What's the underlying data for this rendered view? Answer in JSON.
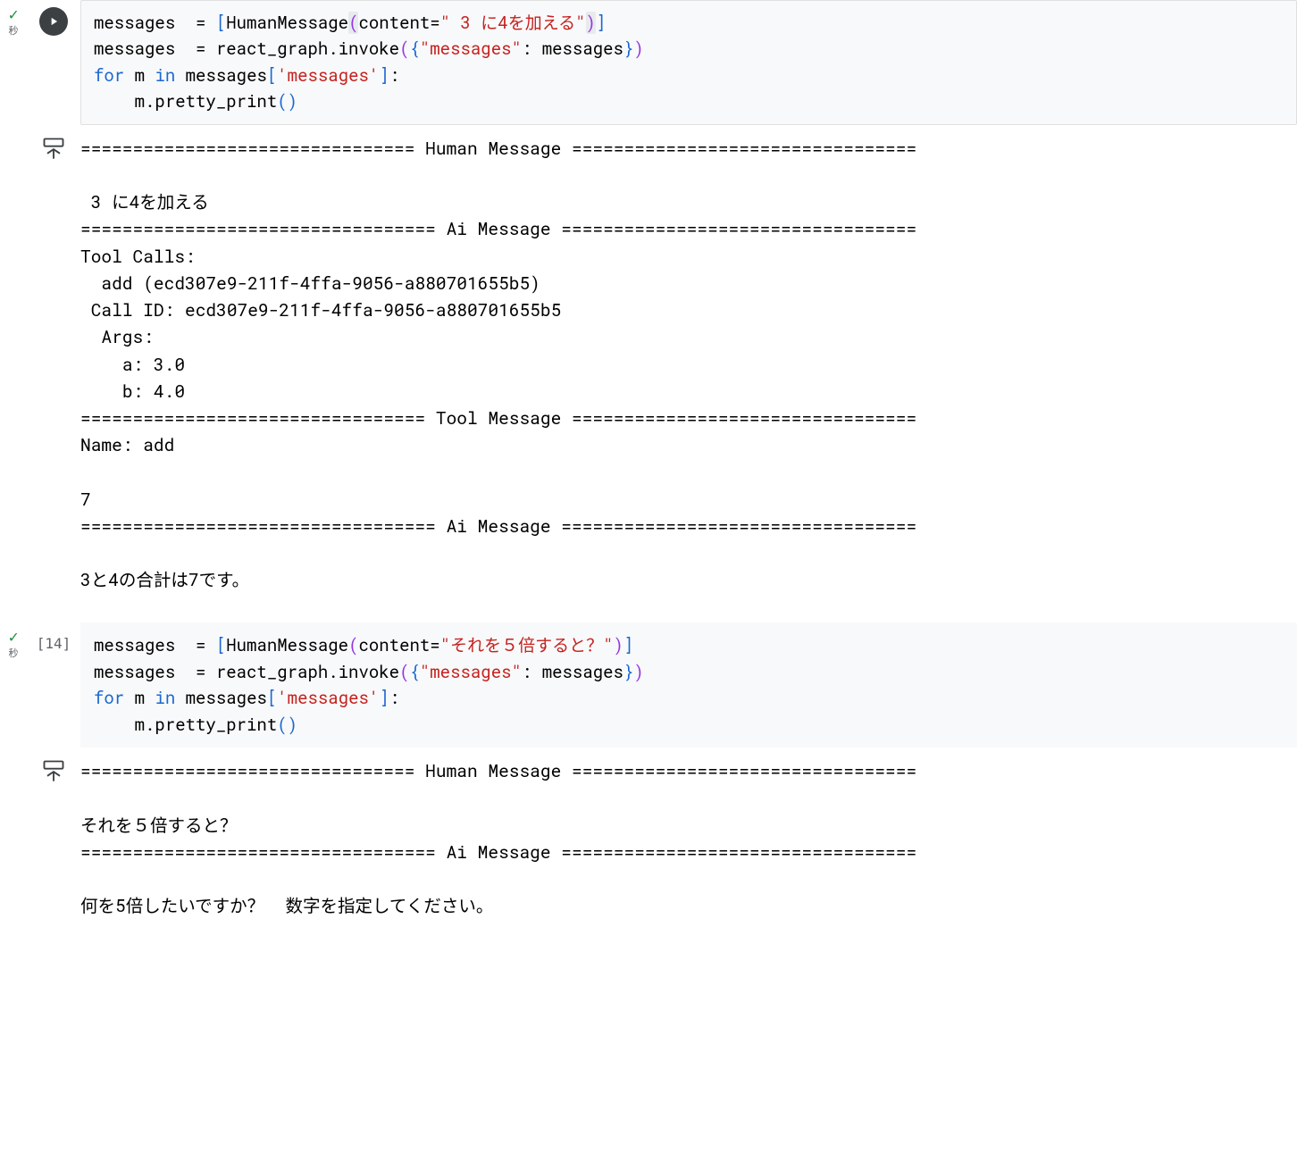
{
  "cells": [
    {
      "status_check": "✓",
      "status_seconds": "秒",
      "exec_label": "",
      "show_play": true,
      "code_tokens": [
        [
          "messages ",
          " = ",
          [
            "brk",
            "["
          ],
          "HumanMessage",
          [
            "hlpar",
            "("
          ],
          "content",
          [
            "op",
            "="
          ],
          [
            "str",
            "\" 3 に4を加える\""
          ],
          [
            "hlpar",
            ")"
          ],
          [
            "brk",
            "]"
          ]
        ],
        [
          "messages ",
          " = ",
          "react_graph",
          ".",
          "invoke",
          [
            "brk2",
            "("
          ],
          [
            "brk",
            "{"
          ],
          [
            "str",
            "\"messages\""
          ],
          ": messages",
          [
            "brk",
            "}"
          ],
          [
            "brk2",
            ")"
          ]
        ],
        [
          [
            "kw",
            "for"
          ],
          " m ",
          [
            "kw",
            "in"
          ],
          " messages",
          [
            "brk",
            "["
          ],
          [
            "str",
            "'messages'"
          ],
          [
            "brk",
            "]"
          ],
          ":"
        ],
        [
          "    m",
          ".",
          "pretty_print",
          [
            "brk",
            "("
          ],
          [
            "brk",
            ")"
          ]
        ]
      ],
      "output": "================================ Human Message =================================\n\n 3 に4を加える\n================================== Ai Message ==================================\nTool Calls:\n  add (ecd307e9-211f-4ffa-9056-a880701655b5)\n Call ID: ecd307e9-211f-4ffa-9056-a880701655b5\n  Args:\n    a: 3.0\n    b: 4.0\n================================= Tool Message =================================\nName: add\n\n7\n================================== Ai Message ==================================\n\n3と4の合計は7です。"
    },
    {
      "status_check": "✓",
      "status_seconds": "秒",
      "exec_label": "[14]",
      "show_play": false,
      "code_tokens": [
        [
          "messages ",
          " = ",
          [
            "brk",
            "["
          ],
          "HumanMessage",
          [
            "brk2",
            "("
          ],
          "content",
          [
            "op",
            "="
          ],
          [
            "str",
            "\"それを５倍すると？\""
          ],
          [
            "brk2",
            ")"
          ],
          [
            "brk",
            "]"
          ]
        ],
        [
          "messages ",
          " = ",
          "react_graph",
          ".",
          "invoke",
          [
            "brk2",
            "("
          ],
          [
            "brk",
            "{"
          ],
          [
            "str",
            "\"messages\""
          ],
          ": messages",
          [
            "brk",
            "}"
          ],
          [
            "brk2",
            ")"
          ]
        ],
        [
          [
            "kw",
            "for"
          ],
          " m ",
          [
            "kw",
            "in"
          ],
          " messages",
          [
            "brk",
            "["
          ],
          [
            "str",
            "'messages'"
          ],
          [
            "brk",
            "]"
          ],
          ":"
        ],
        [
          "    m",
          ".",
          "pretty_print",
          [
            "brk",
            "("
          ],
          [
            "brk",
            ")"
          ]
        ]
      ],
      "output": "================================ Human Message =================================\n\nそれを５倍すると？\n================================== Ai Message ==================================\n\n何を5倍したいですか？  数字を指定してください。"
    }
  ]
}
